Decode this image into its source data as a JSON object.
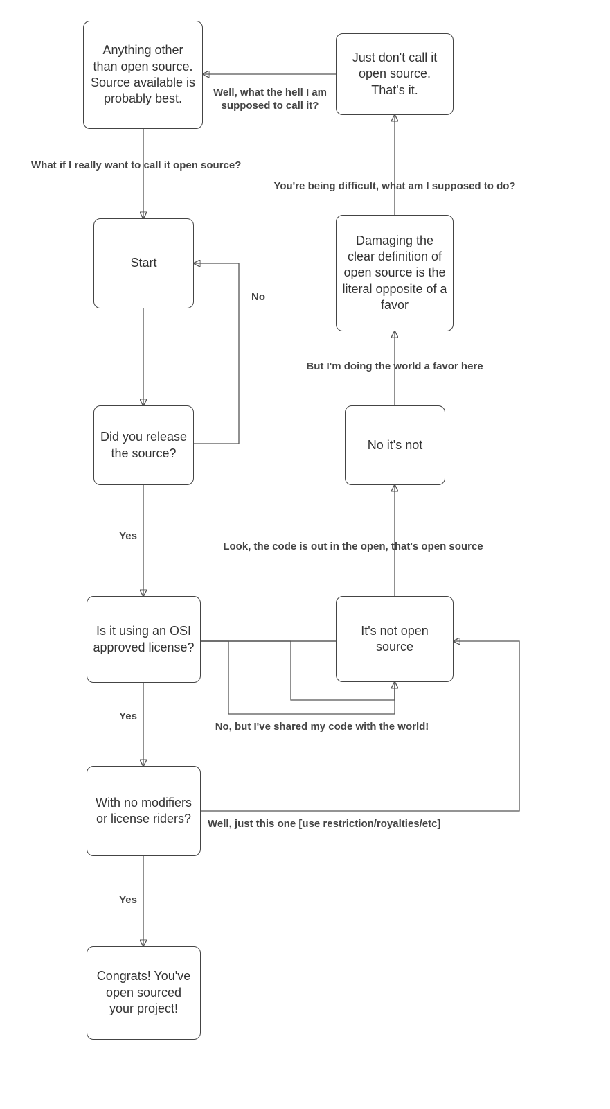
{
  "nodes": {
    "anything": "Anything other than open source. Source available is probably best.",
    "just_dont": "Just don't call it open source. That's it.",
    "start": "Start",
    "damaging": "Damaging the clear definition of open source is the literal opposite of a favor",
    "release": "Did you release the source?",
    "no_its_not": "No it's not",
    "osi": "Is it using an OSI approved license?",
    "not_os": "It's not open source",
    "modifiers": "With no modifiers or license riders?",
    "congrats": "Congrats! You've open sourced your project!"
  },
  "edges": {
    "what_call": "Well, what the hell I am supposed to call it?",
    "difficult": "You're being difficult, what am I supposed to do?",
    "really_want": "What if I really want to call it open source?",
    "no": "No",
    "favor": "But I'm doing the world a favor here",
    "yes1": "Yes",
    "look_open": "Look, the code is out in the open, that's open source",
    "yes2": "Yes",
    "no_shared": "No, but I've shared my code with the world!",
    "just_this_one": "Well, just this one [use restriction/royalties/etc]",
    "yes3": "Yes"
  }
}
